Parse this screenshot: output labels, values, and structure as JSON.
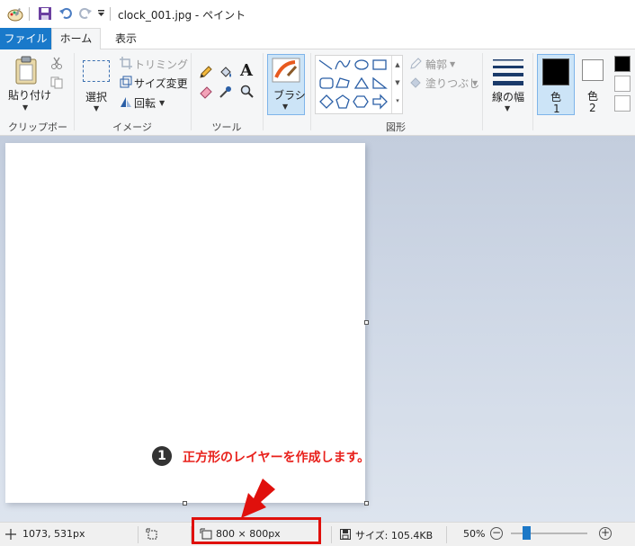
{
  "window": {
    "title": "clock_001.jpg - ペイント"
  },
  "tabs": {
    "file": "ファイル",
    "home": "ホーム",
    "view": "表示"
  },
  "ribbon": {
    "clipboard": {
      "paste": "貼り付け",
      "group": "クリップボード"
    },
    "image": {
      "select": "選択",
      "crop": "トリミング",
      "resize": "サイズ変更",
      "rotate": "回転",
      "group": "イメージ"
    },
    "tools": {
      "group": "ツール"
    },
    "brushes": {
      "label": "ブラシ"
    },
    "shapes": {
      "outline": "輪郭",
      "fill": "塗りつぶし",
      "group": "図形"
    },
    "size": {
      "label": "線の幅"
    },
    "color1": {
      "label": "色",
      "num": "1",
      "value": "#000000"
    },
    "color2": {
      "label": "色",
      "num": "2",
      "value": "#ffffff"
    }
  },
  "annotation": {
    "number": "1",
    "text": "正方形のレイヤーを作成します。"
  },
  "status": {
    "cursor": "1073, 531px",
    "image_size": "800 × 800px",
    "file_size": "サイズ: 105.4KB",
    "zoom": "50%",
    "zoom_fraction": 0.2
  },
  "colors": {
    "accent": "#1979ca",
    "highlight": "#e0100c"
  }
}
